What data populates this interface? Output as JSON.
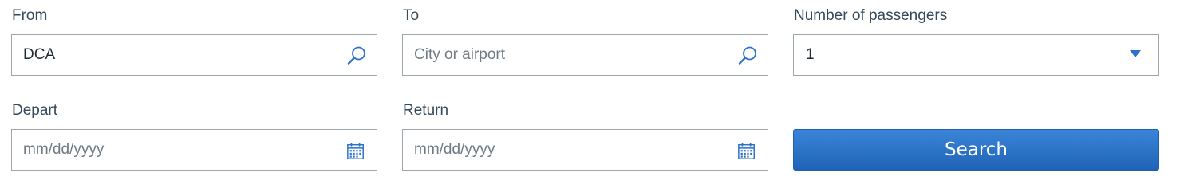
{
  "from": {
    "label": "From",
    "value": "DCA",
    "icon": "search-icon"
  },
  "to": {
    "label": "To",
    "value": "",
    "placeholder": "City or airport",
    "icon": "search-icon"
  },
  "passengers": {
    "label": "Number of passengers",
    "selected": "1",
    "icon": "chevron-down-icon"
  },
  "depart": {
    "label": "Depart",
    "placeholder": "mm/dd/yyyy",
    "icon": "calendar-icon"
  },
  "return": {
    "label": "Return",
    "placeholder": "mm/dd/yyyy",
    "icon": "calendar-icon"
  },
  "search_button": {
    "label": "Search"
  },
  "colors": {
    "accent": "#2b71c8",
    "button_top": "#3a85d8",
    "button_bottom": "#1f63b6",
    "label_text": "#36495a",
    "border": "#9da6ab"
  }
}
